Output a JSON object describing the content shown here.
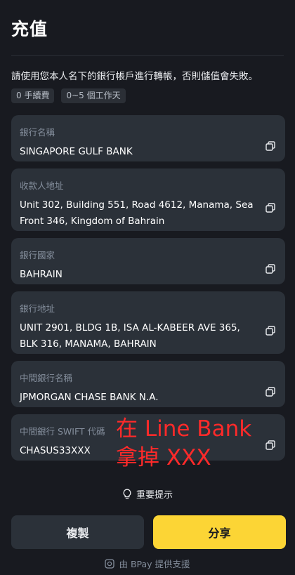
{
  "page": {
    "title": "充值"
  },
  "notice": "請使用您本人名下的銀行帳戶進行轉帳，否則儲值會失敗。",
  "tags": [
    "0 手續費",
    "0~5 個工作天"
  ],
  "fields": [
    {
      "label": "銀行名稱",
      "value": "SINGAPORE GULF BANK"
    },
    {
      "label": "收款人地址",
      "value": "Unit 302, Building 551, Road 4612, Manama, Sea Front 346, Kingdom of Bahrain"
    },
    {
      "label": "銀行國家",
      "value": "BAHRAIN"
    },
    {
      "label": "銀行地址",
      "value": "UNIT 2901, BLDG 1B, ISA AL-KABEER AVE 365, BLK 316, MANAMA, BAHRAIN"
    },
    {
      "label": "中間銀行名稱",
      "value": "JPMORGAN CHASE BANK N.A."
    },
    {
      "label": "中間銀行 SWIFT 代碼",
      "value": "CHASUS33XXX"
    }
  ],
  "hint": "重要提示",
  "buttons": {
    "copy": "複製",
    "share": "分享"
  },
  "powered_by": "由 BPay 提供支援",
  "annotation": {
    "line1": "在 Line Bank",
    "line2": "拿掉 XXX"
  },
  "colors": {
    "background": "#181a20",
    "card": "#2b3139",
    "accent": "#fcd535",
    "annotation": "#ff2a2a"
  }
}
